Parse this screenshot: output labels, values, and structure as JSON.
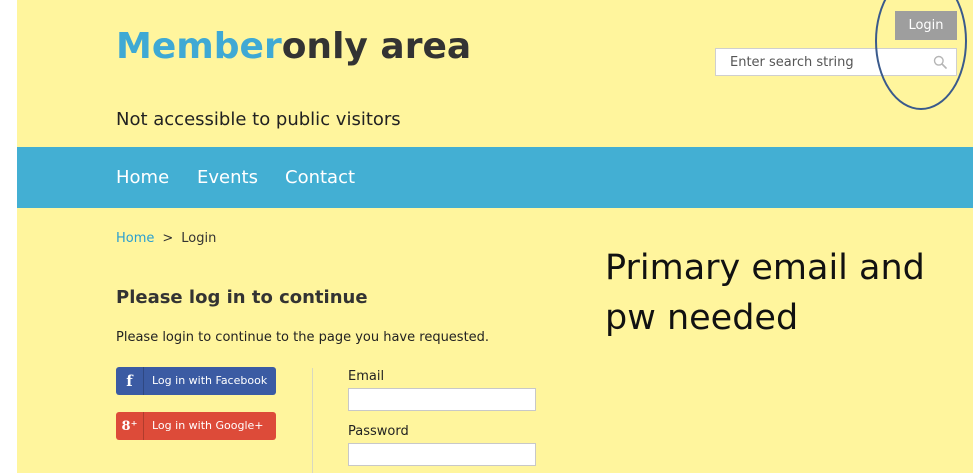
{
  "header": {
    "title_accent": "Member",
    "title_rest": "only area",
    "tagline": "Not accessible to public visitors",
    "login_button": "Login",
    "search_placeholder": "Enter search string"
  },
  "nav": {
    "items": [
      {
        "label": "Home"
      },
      {
        "label": "Events"
      },
      {
        "label": "Contact"
      }
    ]
  },
  "breadcrumb": {
    "home": "Home",
    "separator": ">",
    "current": "Login"
  },
  "login": {
    "heading": "Please log in to continue",
    "intro": "Please login to continue to the page you have requested.",
    "facebook_label": "Log in with Facebook",
    "facebook_icon_glyph": "f",
    "google_label": "Log in with Google+",
    "google_icon_glyph": "8⁺",
    "email_label": "Email",
    "password_label": "Password"
  },
  "annotation": {
    "line1": "Primary email and",
    "line2": "pw needed"
  },
  "colors": {
    "page_background": "#fff59d",
    "nav_background": "#43afd3",
    "title_accent": "#3fa9d4",
    "facebook": "#3b5ba3",
    "google": "#dd4b39",
    "login_button": "#9e9e9e",
    "annotation_circle": "#3a5a8c"
  }
}
